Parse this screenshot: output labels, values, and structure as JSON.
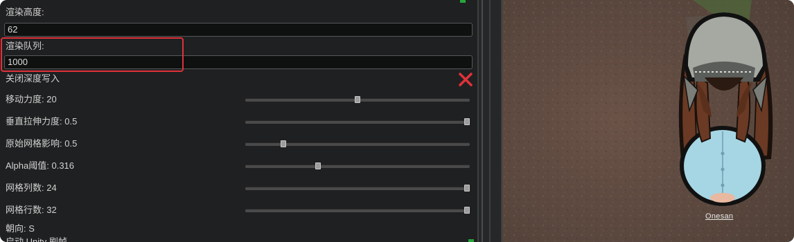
{
  "inspector": {
    "render_height_label": "渲染高度:",
    "render_height_value": "62",
    "render_queue_label": "渲染队列:",
    "render_queue_value": "1000",
    "disable_depth_write_label": "关闭深度写入",
    "sliders": [
      {
        "label": "移动力度: 20",
        "value_fraction": 0.5
      },
      {
        "label": "垂直拉伸力度: 0.5",
        "value_fraction": 1.0
      },
      {
        "label": "原始网格影响: 0.5",
        "value_fraction": 0.16
      },
      {
        "label": "Alpha阈值: 0.316",
        "value_fraction": 0.32
      },
      {
        "label": "网格列数: 24",
        "value_fraction": 1.0
      },
      {
        "label": "网格行数: 32",
        "value_fraction": 1.0
      }
    ],
    "direction_label": "朝向: S",
    "cut_off_label": "启动 Unity 刷帧"
  },
  "scene": {
    "character_name": "Onesan"
  },
  "colors": {
    "panel_bg": "#1f2021",
    "highlight": "#e0323a",
    "close_x": "#e0323a",
    "accent_green": "#28a63a",
    "ground": "#5c4a40",
    "robe": "#a6d6e4",
    "hair": "#6b3a24",
    "hood": "#a5a9a2"
  }
}
